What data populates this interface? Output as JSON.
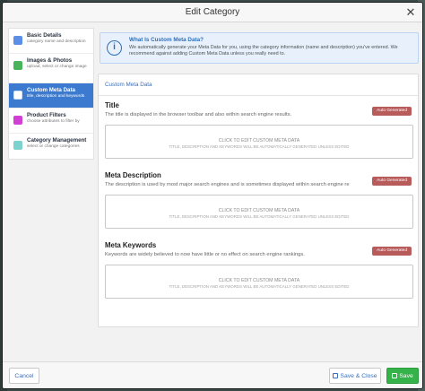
{
  "dialog": {
    "title": "Edit Category",
    "close_glyph": "✕"
  },
  "sidebar": {
    "items": [
      {
        "label": "Basic Details",
        "desc": "category name and description",
        "icon": "pencil-icon",
        "color": "#5b8ee6",
        "active": false
      },
      {
        "label": "Images & Photos",
        "desc": "upload, select or change image",
        "icon": "image-icon",
        "color": "#48b55c",
        "active": false
      },
      {
        "label": "Custom Meta Data",
        "desc": "title, description and keywords",
        "icon": "search-icon",
        "color": "#ffffff",
        "active": true
      },
      {
        "label": "Product Filters",
        "desc": "choose attributes to filter by",
        "icon": "filter-icon",
        "color": "#d23fd4",
        "active": false
      },
      {
        "label": "Category Management",
        "desc": "select or change categories",
        "icon": "sitemap-icon",
        "color": "#7dd2cf",
        "active": false
      }
    ]
  },
  "info": {
    "title": "What Is Custom Meta Data?",
    "text": "We automatically generate your Meta Data for you, using the category information (name and description) you've entered. We recommend against adding Custom Meta Data unless you really need to."
  },
  "panel": {
    "heading": "Custom Meta Data",
    "fields": [
      {
        "label": "Title",
        "desc": "The title is displayed in the browser toolbar and also within search engine results.",
        "badge": "Auto Generated",
        "cta": "CLICK TO EDIT CUSTOM META DATA",
        "note": "TITLE, DESCRIPTION AND KEYWORDS WILL BE AUTOMATICALLY GENERATED UNLESS EDITED"
      },
      {
        "label": "Meta Description",
        "desc": "The description is used by most major search engines and is sometimes displayed within search engine re",
        "badge": "Auto Generated",
        "cta": "CLICK TO EDIT CUSTOM META DATA",
        "note": "TITLE, DESCRIPTION AND KEYWORDS WILL BE AUTOMATICALLY GENERATED UNLESS EDITED"
      },
      {
        "label": "Meta Keywords",
        "desc": "Keywords are widely believed to now have little or no effect on search engine rankings.",
        "badge": "Auto Generated",
        "cta": "CLICK TO EDIT CUSTOM META DATA",
        "note": "TITLE, DESCRIPTION AND KEYWORDS WILL BE AUTOMATICALLY GENERATED UNLESS EDITED"
      }
    ]
  },
  "footer": {
    "cancel_label": "Cancel",
    "save_close_label": "Save & Close",
    "save_label": "Save"
  },
  "colors": {
    "accent": "#3c7ad0",
    "save_green": "#36b24a",
    "badge_red": "#b85b5b"
  }
}
